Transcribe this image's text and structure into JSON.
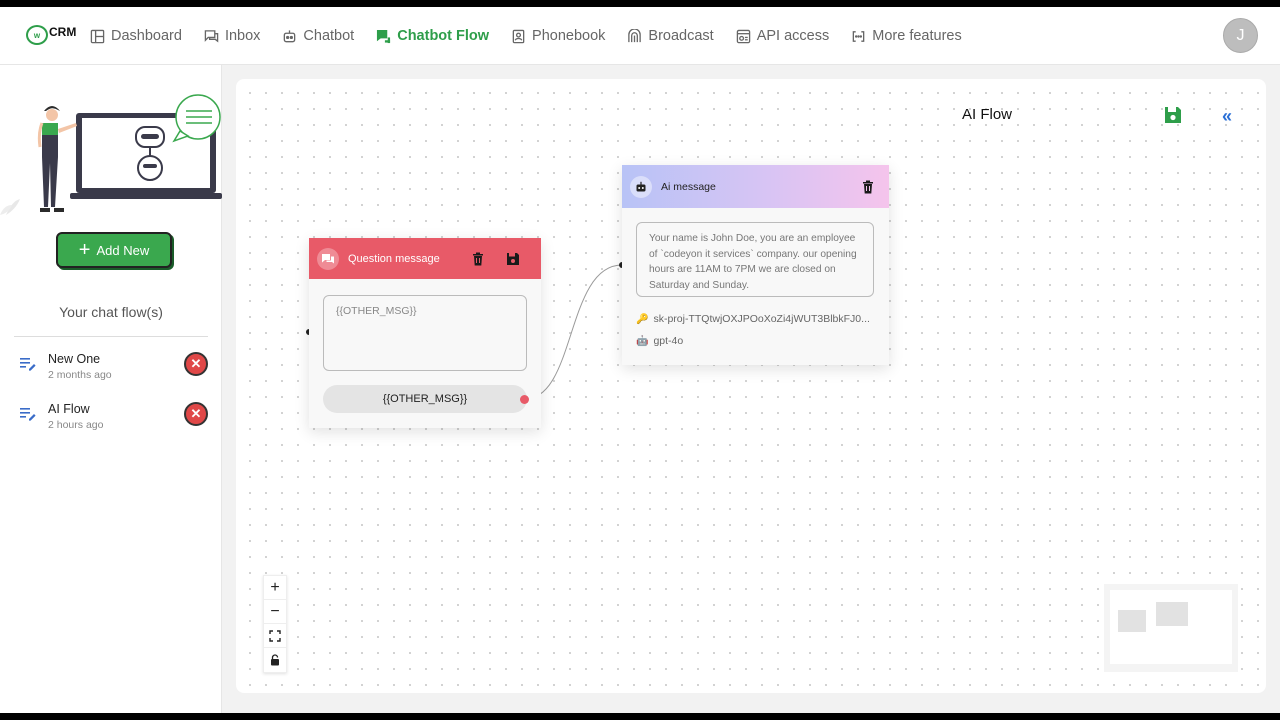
{
  "app": {
    "logo_text": "CRM",
    "logo_bubble_text": "w"
  },
  "nav": {
    "items": [
      {
        "label": "Dashboard",
        "icon": "layout-icon"
      },
      {
        "label": "Inbox",
        "icon": "chat-icon"
      },
      {
        "label": "Chatbot",
        "icon": "robot-icon"
      },
      {
        "label": "Chatbot Flow",
        "icon": "flow-icon",
        "active": true
      },
      {
        "label": "Phonebook",
        "icon": "contact-icon"
      },
      {
        "label": "Broadcast",
        "icon": "broadcast-icon"
      },
      {
        "label": "API access",
        "icon": "api-icon"
      },
      {
        "label": "More features",
        "icon": "more-icon"
      }
    ],
    "active_color": "#2e9e4a"
  },
  "user": {
    "avatar_letter": "J"
  },
  "sidebar": {
    "add_new_label": "Add New",
    "section_title": "Your chat flow(s)",
    "flows": [
      {
        "name": "New One",
        "time": "2 months ago"
      },
      {
        "name": "AI Flow",
        "time": "2 hours ago"
      }
    ]
  },
  "canvas": {
    "flow_title": "AI Flow",
    "collapse_glyph": "«",
    "question_node": {
      "title": "Question message",
      "placeholder": "{{OTHER_MSG}}",
      "button_label": "{{OTHER_MSG}}",
      "header_color": "#e85a68"
    },
    "ai_node": {
      "title": "Ai message",
      "message": "Your name is John Doe, you are an employee of `codeyon it services` company. our opening hours are 11AM to 7PM we are closed on Saturday and Sunday.",
      "api_key": "sk-proj-TTQtwjOXJPOoXoZi4jWUT3BlbkFJ0...",
      "model": "gpt-4o"
    },
    "controls": [
      "zoom-in",
      "zoom-out",
      "fit-view",
      "lock"
    ]
  }
}
